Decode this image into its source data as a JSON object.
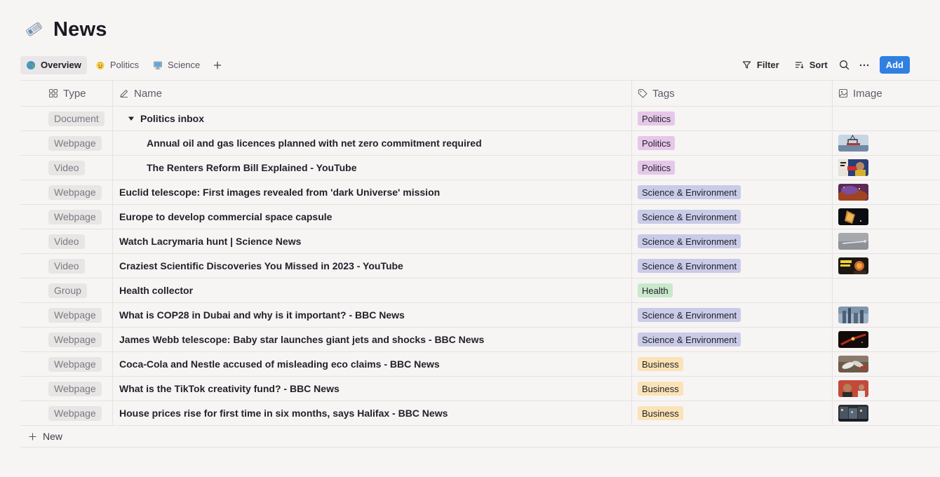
{
  "page": {
    "title": "News",
    "icon": "newspaper-roll-icon"
  },
  "tabs": [
    {
      "label": "Overview",
      "icon": "globe-icon",
      "active": true
    },
    {
      "label": "Politics",
      "icon": "face-icon",
      "active": false
    },
    {
      "label": "Science",
      "icon": "computer-icon",
      "active": false
    }
  ],
  "toolbar": {
    "filter_label": "Filter",
    "sort_label": "Sort",
    "add_label": "Add",
    "add_color": "#2f80e0"
  },
  "columns": {
    "type": "Type",
    "name": "Name",
    "tags": "Tags",
    "image": "Image"
  },
  "tag_colors": {
    "Politics": "#e6c7ea",
    "Science & Environment": "#c9cbe8",
    "Health": "#c9e8cc",
    "Business": "#fbe3b8"
  },
  "rows": [
    {
      "type": "Document",
      "name": "Politics inbox",
      "tag": "Politics",
      "image": null
    },
    {
      "type": "Webpage",
      "name": "Annual oil and gas licences planned with net zero commitment required",
      "tag": "Politics",
      "image": "oil-rig"
    },
    {
      "type": "Video",
      "name": "The Renters Reform Bill Explained - YouTube",
      "tag": "Politics",
      "image": "video-evicted"
    },
    {
      "type": "Webpage",
      "name": "Euclid telescope: First images revealed from 'dark Universe' mission",
      "tag": "Science & Environment",
      "image": "nebula"
    },
    {
      "type": "Webpage",
      "name": "Europe to develop commercial space capsule",
      "tag": "Science & Environment",
      "image": "capsule"
    },
    {
      "type": "Video",
      "name": "Watch Lacrymaria hunt | Science News",
      "tag": "Science & Environment",
      "image": "microscope"
    },
    {
      "type": "Video",
      "name": "Craziest Scientific Discoveries You Missed in 2023 - YouTube",
      "tag": "Science & Environment",
      "image": "discoveries"
    },
    {
      "type": "Group",
      "name": "Health collector",
      "tag": "Health",
      "image": null
    },
    {
      "type": "Webpage",
      "name": "What is COP28 in Dubai and why is it important? - BBC News",
      "tag": "Science & Environment",
      "image": "dubai"
    },
    {
      "type": "Webpage",
      "name": "James Webb telescope: Baby star launches giant jets and shocks - BBC News",
      "tag": "Science & Environment",
      "image": "jets"
    },
    {
      "type": "Webpage",
      "name": "Coca-Cola and Nestle accused of misleading eco claims - BBC News",
      "tag": "Business",
      "image": "bottles"
    },
    {
      "type": "Webpage",
      "name": "What is the TikTok creativity fund? - BBC News",
      "tag": "Business",
      "image": "tiktok"
    },
    {
      "type": "Webpage",
      "name": "House prices rise for first time in six months, says Halifax - BBC News",
      "tag": "Business",
      "image": "houses"
    }
  ],
  "new_label": "New"
}
